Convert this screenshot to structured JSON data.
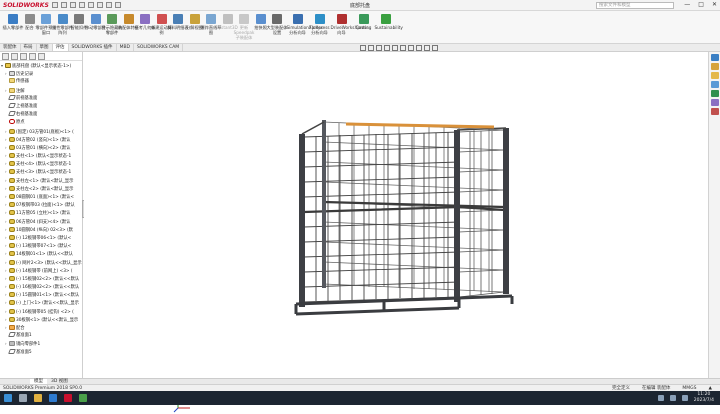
{
  "app": {
    "logo_text": "SOLIDWORKS",
    "document_title": "底部托盘",
    "search_placeholder": "搜索文件和模型",
    "window_controls": [
      "—",
      "□",
      "✕"
    ],
    "logo_color": "#c8102e"
  },
  "ribbon": {
    "buttons": [
      {
        "label": "插入零部件",
        "icon": "insert-component-icon",
        "color": "#3b7dc4",
        "enabled": true
      },
      {
        "label": "配合",
        "icon": "mate-icon",
        "color": "#8c8c8c",
        "enabled": true
      },
      {
        "label": "零部件预览窗口",
        "icon": "preview-window-icon",
        "color": "#6aa0d8",
        "enabled": true
      },
      {
        "label": "线性零部件阵列",
        "icon": "pattern-icon",
        "color": "#4a8bc9",
        "enabled": true
      },
      {
        "label": "智能扣件",
        "icon": "fastener-icon",
        "color": "#7a7a7a",
        "enabled": true
      },
      {
        "label": "移动零部件",
        "icon": "move-component-icon",
        "color": "#5a8fcf",
        "enabled": true
      },
      {
        "label": "显示隐藏的零部件",
        "icon": "show-hidden-icon",
        "color": "#5a9a5a",
        "enabled": true
      },
      {
        "label": "装配体特征",
        "icon": "assembly-feature-icon",
        "color": "#c78a2c",
        "enabled": true
      },
      {
        "label": "参考几何体",
        "icon": "reference-geometry-icon",
        "color": "#8a6fc2",
        "enabled": true
      },
      {
        "label": "新建运动算例",
        "icon": "motion-study-icon",
        "color": "#d05050",
        "enabled": true
      },
      {
        "label": "材料明细表",
        "icon": "bom-icon",
        "color": "#4a7fb5",
        "enabled": true
      },
      {
        "label": "分解视图",
        "icon": "exploded-view-icon",
        "color": "#c9a23a",
        "enabled": true
      },
      {
        "label": "爆炸直线草图",
        "icon": "explode-line-icon",
        "color": "#7aa6d1",
        "enabled": true
      },
      {
        "label": "Instant3D",
        "icon": "instant3d-icon",
        "color": "#c0c0c0",
        "enabled": false
      },
      {
        "label": "更新Speedpak子装配体",
        "icon": "speedpak-icon",
        "color": "#c8c8c8",
        "enabled": false
      },
      {
        "label": "拍快照",
        "icon": "snapshot-icon",
        "color": "#5a8fcf",
        "enabled": true
      },
      {
        "label": "大型装配体设置",
        "icon": "large-assembly-icon",
        "color": "#6a6a6a",
        "enabled": true
      }
    ],
    "addins": [
      {
        "label": "SimulationXpress 分析向导",
        "icon": "simxpress-icon",
        "color": "#3a6fb0"
      },
      {
        "label": "FloXpress 分析向导",
        "icon": "floxpress-icon",
        "color": "#2d8fc7"
      },
      {
        "label": "DriveWorksXpress 向导",
        "icon": "driveworks-icon",
        "color": "#b03030"
      },
      {
        "label": "Costing",
        "icon": "costing-icon",
        "color": "#3a9a5a"
      },
      {
        "label": "Sustainability",
        "icon": "sustainability-icon",
        "color": "#3aa040"
      }
    ]
  },
  "command_tabs": [
    "装配体",
    "布局",
    "草图",
    "评估",
    "SOLIDWORKS 插件",
    "MBD",
    "SOLIDWORKS CAM"
  ],
  "active_command_tab": 3,
  "feature_tree": {
    "items": [
      {
        "text": "底部托盘 (默认<显示状态-1>)",
        "icon": "asm",
        "indent": 0,
        "arrow": "▾"
      },
      {
        "text": "历史记录",
        "icon": "hist",
        "indent": 1,
        "arrow": "›"
      },
      {
        "text": "传感器",
        "icon": "folder",
        "indent": 1,
        "arrow": ""
      },
      {
        "text": "注解",
        "icon": "folder",
        "indent": 1,
        "arrow": "›"
      },
      {
        "text": "前视基准面",
        "icon": "plane",
        "indent": 1,
        "arrow": ""
      },
      {
        "text": "上视基准面",
        "icon": "plane",
        "indent": 1,
        "arrow": ""
      },
      {
        "text": "右视基准面",
        "icon": "plane",
        "indent": 1,
        "arrow": ""
      },
      {
        "text": "原点",
        "icon": "origin",
        "indent": 1,
        "arrow": ""
      },
      {
        "text": "(固定) 03方管01(底板)<1> (",
        "icon": "part",
        "indent": 1,
        "arrow": "›"
      },
      {
        "text": "04方管02 (竖向)<1> (默认",
        "icon": "part",
        "indent": 1,
        "arrow": "›"
      },
      {
        "text": "03方管01 (横向)<2> (默认",
        "icon": "part",
        "indent": 1,
        "arrow": "›"
      },
      {
        "text": "支柱<1> (默认<显示状态-1",
        "icon": "part",
        "indent": 1,
        "arrow": "›"
      },
      {
        "text": "支柱<4> (默认<显示状态-1",
        "icon": "part",
        "indent": 1,
        "arrow": "›"
      },
      {
        "text": "支柱<3> (默认<显示状态-1",
        "icon": "part",
        "indent": 1,
        "arrow": "›"
      },
      {
        "text": "支柱左<1> (默认<默认_显示",
        "icon": "part",
        "indent": 1,
        "arrow": "›"
      },
      {
        "text": "支柱左<2> (默认<默认_显示",
        "icon": "part",
        "indent": 1,
        "arrow": "›"
      },
      {
        "text": "08圆钢01 (底面)<1> (默认<",
        "icon": "part",
        "indent": 1,
        "arrow": "›"
      },
      {
        "text": "07板钢带03 (拉面)<1> (默认",
        "icon": "part",
        "indent": 1,
        "arrow": "›"
      },
      {
        "text": "11方管05 (立柱)<1> (默认",
        "icon": "part",
        "indent": 1,
        "arrow": "›"
      },
      {
        "text": "06方管04 (斜支)<4> (默认",
        "icon": "part",
        "indent": 1,
        "arrow": "›"
      },
      {
        "text": "10圆钢04 (纵向) 02<3> (默",
        "icon": "part",
        "indent": 1,
        "arrow": "›"
      },
      {
        "text": "(-) 12板钢带06<1> (默认<",
        "icon": "part",
        "indent": 1,
        "arrow": "›"
      },
      {
        "text": "(-) 13板钢带07<1> (默认<",
        "icon": "part",
        "indent": 1,
        "arrow": "›"
      },
      {
        "text": "14板钢01<1> (默认<<默认",
        "icon": "part",
        "indent": 1,
        "arrow": "›"
      },
      {
        "text": "(-) 网片2<3> (默认<<默认_显示",
        "icon": "part",
        "indent": 1,
        "arrow": "›"
      },
      {
        "text": "(-) 14板钢带 (前网上) <3> (",
        "icon": "part",
        "indent": 1,
        "arrow": "›"
      },
      {
        "text": "(-) 15板钢02<2> (默认<<默认",
        "icon": "part",
        "indent": 1,
        "arrow": "›"
      },
      {
        "text": "(-) 16板钢02<2> (默认<<默认",
        "icon": "part",
        "indent": 1,
        "arrow": "›"
      },
      {
        "text": "(-) 15圆钢01<1> (默认<<默认",
        "icon": "part",
        "indent": 1,
        "arrow": "›"
      },
      {
        "text": "(-) 上门<1> (默认<<默认_显示",
        "icon": "part",
        "indent": 1,
        "arrow": "›"
      },
      {
        "text": "(-) 16板钢带05 (挂钩) <2> (",
        "icon": "part",
        "indent": 1,
        "arrow": "›"
      },
      {
        "text": "30板钢<1> (默认<<默认_显示",
        "icon": "part",
        "indent": 1,
        "arrow": "›"
      },
      {
        "text": "配合",
        "icon": "mate",
        "indent": 1,
        "arrow": "›"
      },
      {
        "text": "基准面1",
        "icon": "plane",
        "indent": 1,
        "arrow": ""
      },
      {
        "text": "镜向零部件1",
        "icon": "grey",
        "indent": 1,
        "arrow": "›"
      },
      {
        "text": "基准面5",
        "icon": "plane",
        "indent": 1,
        "arrow": ""
      }
    ]
  },
  "bottom_tabs": [
    "模型",
    "3D 视图"
  ],
  "active_bottom_tab": 0,
  "status": {
    "left": "SOLIDWORKS Premium 2018 SP0.0",
    "right": [
      "完全定义",
      "在编辑 装配体",
      "MMGS",
      "▲"
    ]
  },
  "taskbar": {
    "time": "11:20",
    "date": "2023/7/4"
  }
}
